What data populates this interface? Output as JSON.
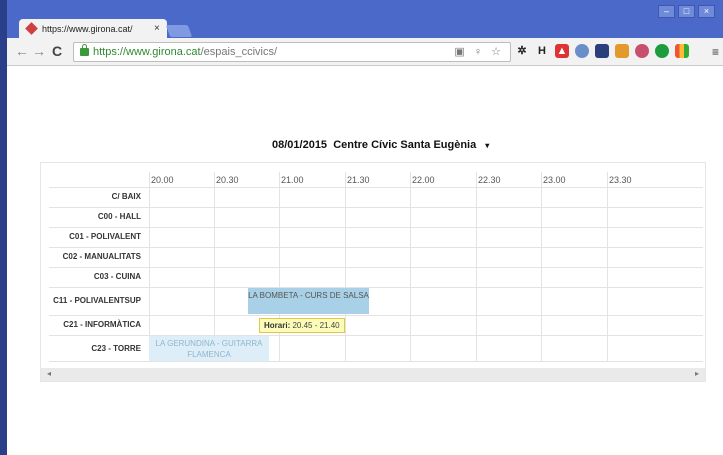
{
  "browser": {
    "tab_title": "https://www.girona.cat/",
    "tab_close": "×",
    "url_secure": "https://www.girona.cat",
    "url_path": "/espais_ccivics/",
    "window_buttons": [
      "–",
      "□",
      "×"
    ]
  },
  "page": {
    "date": "08/01/2015",
    "centre": "Centre Cívic Santa Eugènia",
    "dropdown_arrow": "▾"
  },
  "schedule": {
    "time_slots": [
      "20.00",
      "20.30",
      "21.00",
      "21.30",
      "22.00",
      "22.30",
      "23.00",
      "23.30"
    ],
    "rooms": [
      "C/ BAIX",
      "C00 - HALL",
      "C01 - POLIVALENT",
      "C02 - MANUALITATS",
      "C03 - CUINA",
      "C11 - POLIVALENTSUP",
      "C21 - INFORMÀTICA",
      "C23 - TORRE"
    ],
    "events": [
      {
        "title": "LA BOMBETA - CURS DE SALSA",
        "room": "C11 - POLIVALENTSUP",
        "start": "20.45",
        "end": "21.40",
        "color": "#a8d0e6"
      },
      {
        "title": "LA GERUNDINA - GUITARRA FLAMENCA",
        "room": "C23 - TORRE",
        "start": "20.00",
        "end": "20.55",
        "color": "#ddeef8"
      }
    ],
    "tooltip": {
      "label": "Horari:",
      "value": "20.45 - 21.40"
    }
  },
  "scrollbar": {
    "left_arrow": "◂",
    "right_arrow": "▸"
  },
  "colors": {
    "titlebar": "#4a69c9",
    "secure_url": "#2f8a2f",
    "event_primary": "#a8d0e6",
    "tooltip_bg": "#fdfbb8"
  }
}
